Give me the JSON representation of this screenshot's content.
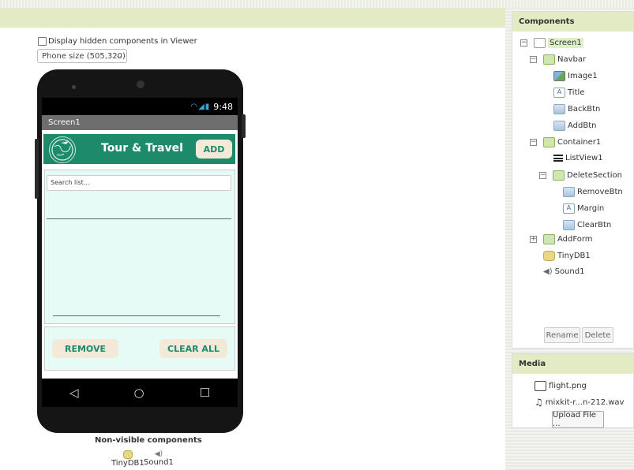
{
  "viewer": {
    "hidden_components_label": "Display hidden components in Viewer",
    "phone_size": "Phone size (505,320)"
  },
  "phone": {
    "status_time": "9:48",
    "screen_title": "Screen1",
    "navbar_title": "Tour & Travel",
    "add_label": "ADD",
    "search_placeholder": "Search list...",
    "remove_label": "REMOVE",
    "clear_label": "CLEAR ALL"
  },
  "non_visible": {
    "title": "Non-visible components",
    "items": [
      "TinyDB1",
      "Sound1"
    ]
  },
  "components": {
    "header": "Components",
    "tree": [
      {
        "label": "Screen1",
        "icon": "screen-icon"
      },
      {
        "label": "Navbar",
        "icon": "horizontal-arrangement-icon"
      },
      {
        "label": "Image1",
        "icon": "image-icon"
      },
      {
        "label": "Title",
        "icon": "label-icon"
      },
      {
        "label": "BackBtn",
        "icon": "button-icon"
      },
      {
        "label": "AddBtn",
        "icon": "button-icon"
      },
      {
        "label": "Container1",
        "icon": "vertical-arrangement-icon"
      },
      {
        "label": "ListView1",
        "icon": "listview-icon"
      },
      {
        "label": "DeleteSection",
        "icon": "horizontal-arrangement-icon"
      },
      {
        "label": "RemoveBtn",
        "icon": "button-icon"
      },
      {
        "label": "Margin",
        "icon": "label-icon"
      },
      {
        "label": "ClearBtn",
        "icon": "button-icon"
      },
      {
        "label": "AddForm",
        "icon": "vertical-arrangement-icon"
      },
      {
        "label": "TinyDB1",
        "icon": "tinydb-icon"
      },
      {
        "label": "Sound1",
        "icon": "sound-icon"
      }
    ],
    "rename_label": "Rename",
    "delete_label": "Delete"
  },
  "media": {
    "header": "Media",
    "files": [
      "flight.png",
      "mixkit-r...n-212.wav"
    ],
    "upload_label": "Upload File ..."
  },
  "colors": {
    "header_green": "#e2ebc4",
    "navbar_teal": "#1c8a6b",
    "button_cream": "#f2e9d8",
    "list_bg": "#e6fbf5"
  }
}
